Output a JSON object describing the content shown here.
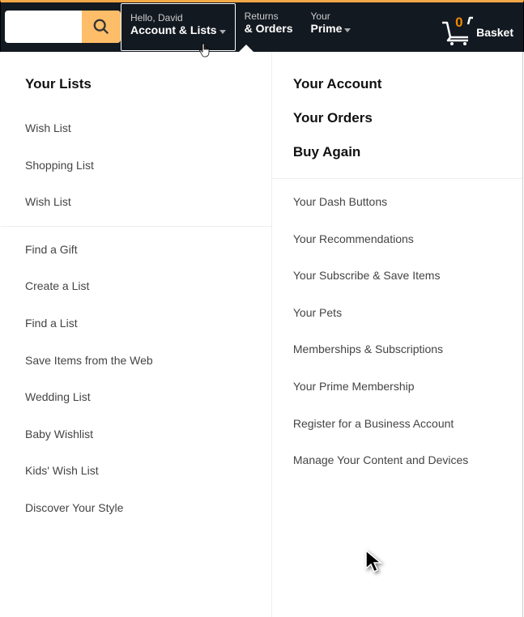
{
  "nav": {
    "account": {
      "line1": "Hello, David",
      "line2": "Account & Lists"
    },
    "orders": {
      "line1": "Returns",
      "line2": "& Orders"
    },
    "prime": {
      "line1": "Your",
      "line2": "Prime"
    },
    "basket": {
      "count": "0",
      "label": "Basket"
    }
  },
  "left": {
    "heading": "Your Lists",
    "group1": [
      "Wish List",
      "Shopping List",
      "Wish List"
    ],
    "group2": [
      "Find a Gift",
      "Create a List",
      "Find a List",
      "Save Items from the Web",
      "Wedding List",
      "Baby Wishlist",
      "Kids' Wish List",
      "Discover Your Style"
    ]
  },
  "right": {
    "big": [
      "Your Account",
      "Your Orders",
      "Buy Again"
    ],
    "items": [
      "Your Dash Buttons",
      "Your Recommendations",
      "Your Subscribe & Save Items",
      "Your Pets",
      "Memberships & Subscriptions",
      "Your Prime Membership",
      "Register for a Business Account",
      "Manage Your Content and Devices"
    ]
  },
  "colors": {
    "accent": "#febd69",
    "count": "#f08804"
  }
}
